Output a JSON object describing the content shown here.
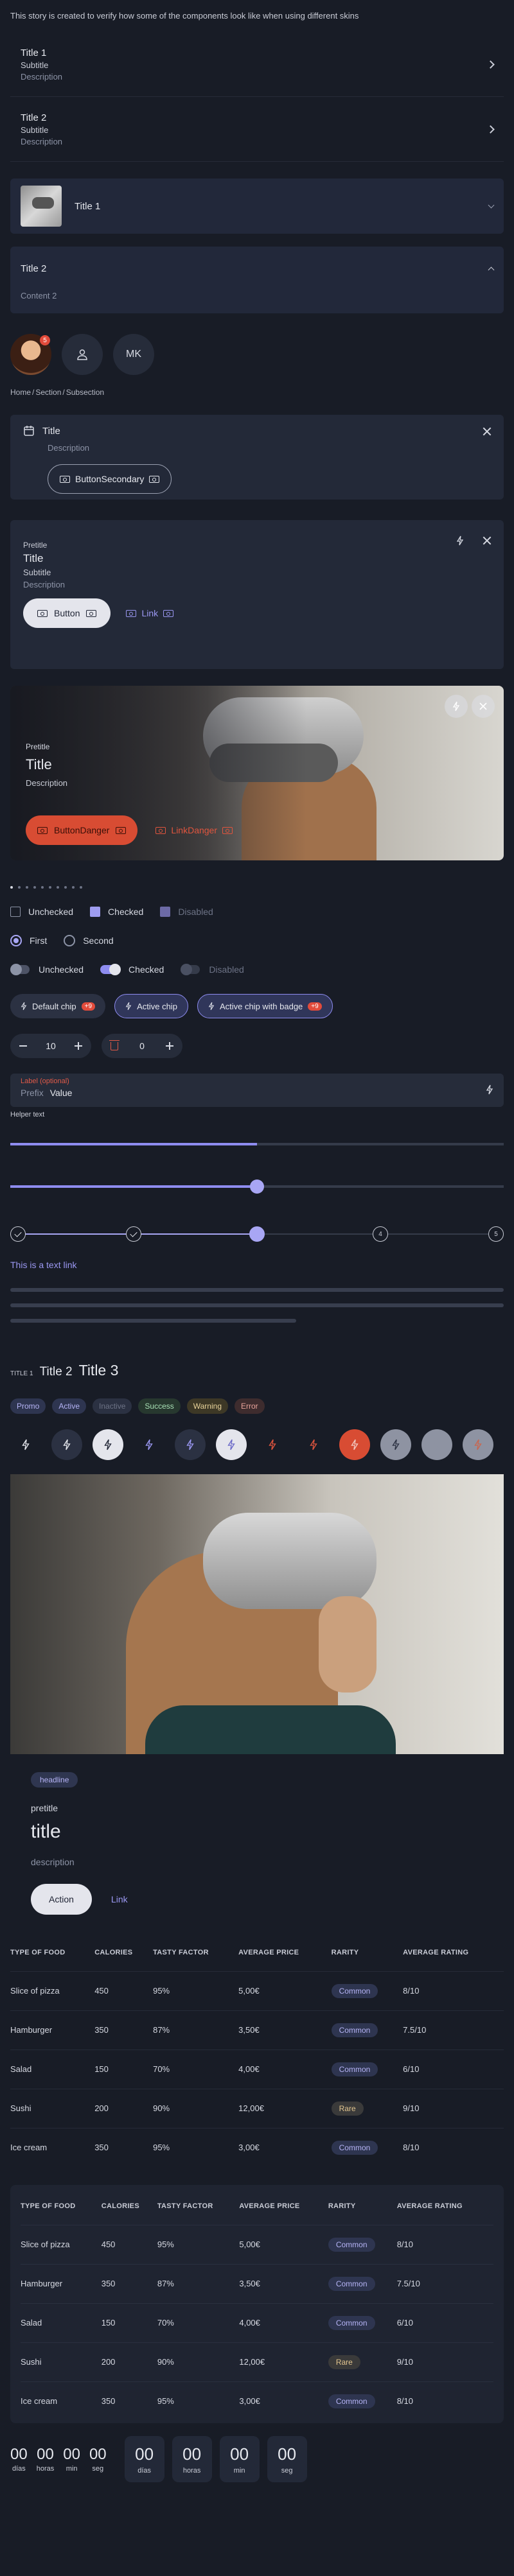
{
  "intro": "This story is created to verify how some of the components look like when using different skins",
  "list": [
    {
      "title": "Title 1",
      "subtitle": "Subtitle",
      "description": "Description"
    },
    {
      "title": "Title 2",
      "subtitle": "Subtitle",
      "description": "Description"
    }
  ],
  "accordion1": {
    "label": "Title 1"
  },
  "accordion2": {
    "label": "Title 2",
    "content": "Content 2"
  },
  "avatars": {
    "badge": "5",
    "initials": "MK"
  },
  "breadcrumb": [
    "Home",
    "Section",
    "Subsection"
  ],
  "dialog1": {
    "title": "Title",
    "description": "Description",
    "button": "ButtonSecondary"
  },
  "dialog2": {
    "pretitle": "Pretitle",
    "title": "Title",
    "subtitle": "Subtitle",
    "description": "Description",
    "button": "Button",
    "link": "Link"
  },
  "hero": {
    "pretitle": "Pretitle",
    "title": "Title",
    "description": "Description",
    "button": "ButtonDanger",
    "link": "LinkDanger"
  },
  "pagination": {
    "count": 10,
    "active": 0
  },
  "checkboxes": {
    "unchecked": "Unchecked",
    "checked": "Checked",
    "disabled": "Disabled"
  },
  "radios": {
    "first": "First",
    "second": "Second"
  },
  "switches": {
    "unchecked": "Unchecked",
    "checked": "Checked",
    "disabled": "Disabled"
  },
  "chips": {
    "default": "Default chip",
    "default_badge": "+9",
    "active": "Active chip",
    "badge": "Active chip with badge",
    "badge_count": "+9"
  },
  "steppers": {
    "first": "10",
    "second": "0"
  },
  "field": {
    "label": "Label (optional)",
    "prefix": "Prefix",
    "value": "Value",
    "helper": "Helper text"
  },
  "progress": {
    "value": 0.5
  },
  "slider": {
    "value": 0.5
  },
  "stepper_flow": {
    "current": 3,
    "total": 5,
    "step4": "4",
    "step5": "5"
  },
  "text_link": "This is a text link",
  "titles": {
    "t1": "TITLE 1",
    "t2": "Title 2",
    "t3": "Title 3"
  },
  "tags": [
    {
      "label": "Promo",
      "bg": "#2e3550",
      "fg": "#b6b4f6"
    },
    {
      "label": "Active",
      "bg": "#2e3550",
      "fg": "#b6b4f6"
    },
    {
      "label": "Inactive",
      "bg": "#2b3142",
      "fg": "#6d7386"
    },
    {
      "label": "Success",
      "bg": "#27382f",
      "fg": "#a8e0b5"
    },
    {
      "label": "Warning",
      "bg": "#3d3826",
      "fg": "#e8d39a"
    },
    {
      "label": "Error",
      "bg": "#3e2c2e",
      "fg": "#e8a39a"
    }
  ],
  "post": {
    "headline": "headline",
    "pretitle": "pretitle",
    "title": "title",
    "description": "description",
    "button": "Action",
    "link": "Link"
  },
  "table": {
    "headers": [
      "TYPE OF FOOD",
      "CALORIES",
      "TASTY FACTOR",
      "AVERAGE PRICE",
      "RARITY",
      "AVERAGE RATING"
    ],
    "rows": [
      [
        "Slice of pizza",
        "450",
        "95%",
        "5,00€",
        "Common",
        "8/10"
      ],
      [
        "Hamburger",
        "350",
        "87%",
        "3,50€",
        "Common",
        "7.5/10"
      ],
      [
        "Salad",
        "150",
        "70%",
        "4,00€",
        "Common",
        "6/10"
      ],
      [
        "Sushi",
        "200",
        "90%",
        "12,00€",
        "Rare",
        "9/10"
      ],
      [
        "Ice cream",
        "350",
        "95%",
        "3,00€",
        "Common",
        "8/10"
      ]
    ]
  },
  "timer": {
    "days": "00",
    "hours": "00",
    "minutes": "00",
    "seconds": "00",
    "days_label": "días",
    "hours_label": "horas",
    "minutes_label": "min",
    "seconds_label": "seg"
  },
  "colors": {
    "accent": "#8e8cf0",
    "danger": "#d84c33",
    "background": "#181c26",
    "surface": "#1f2431"
  }
}
